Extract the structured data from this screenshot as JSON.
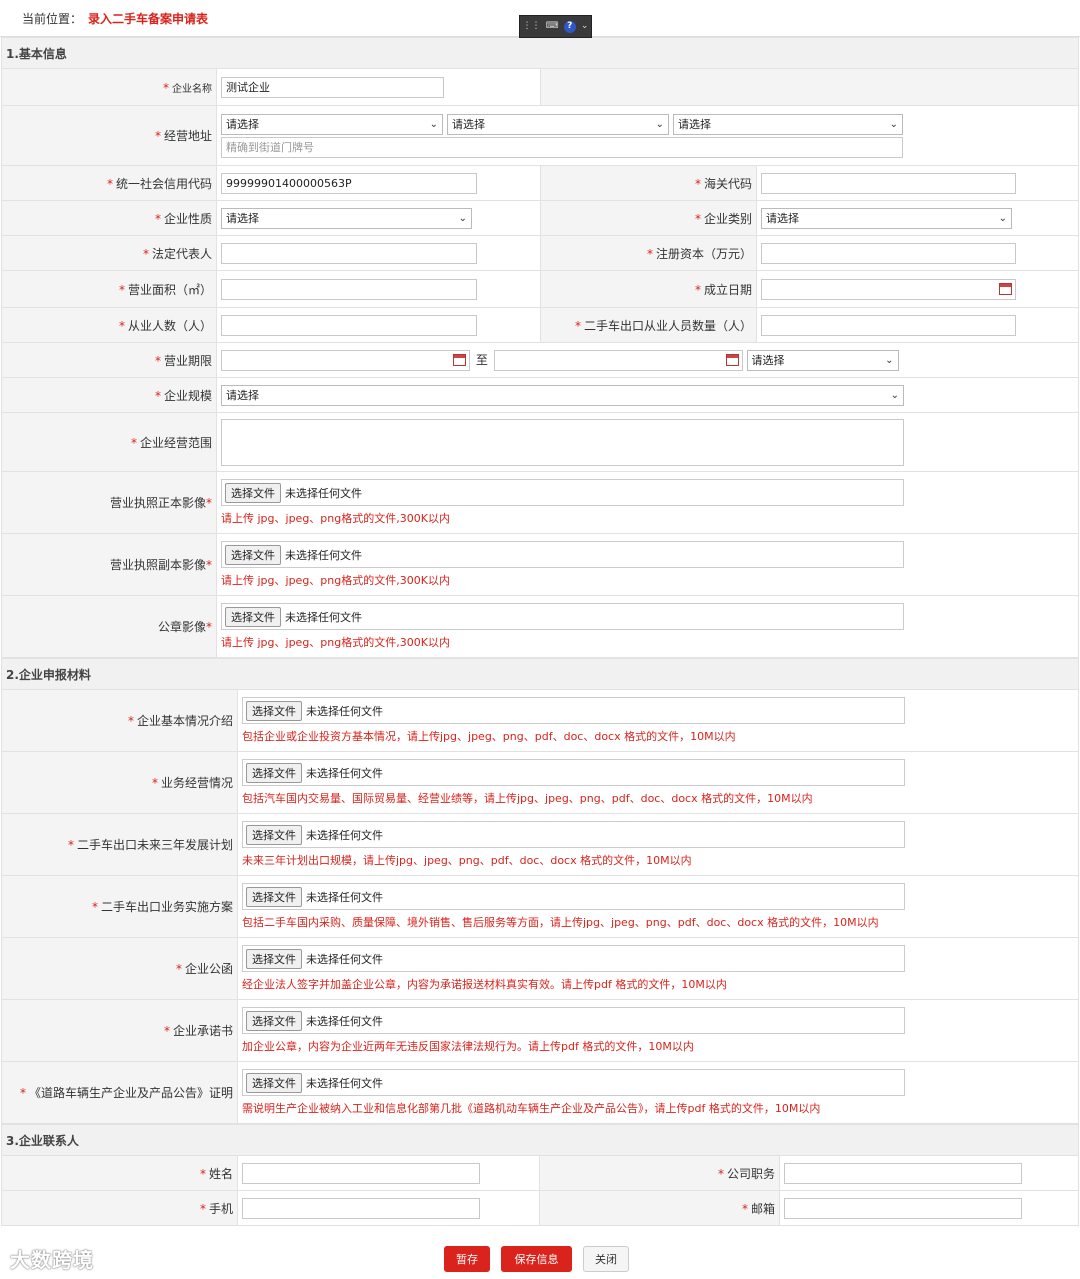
{
  "breadcrumb": {
    "label": "当前位置：",
    "current": "录入二手车备案申请表"
  },
  "sections": {
    "basic": "1.基本信息",
    "materials": "2.企业申报材料",
    "contact": "3.企业联系人"
  },
  "basic": {
    "company_name_label": "企业名称",
    "company_name_value": "测试企业",
    "address_label": "经营地址",
    "address_select1": "请选择",
    "address_select2": "请选择",
    "address_select3": "请选择",
    "address_detail_placeholder": "精确到街道门牌号",
    "credit_code_label": "统一社会信用代码",
    "credit_code_value": "99999901400000563P",
    "customs_code_label": "海关代码",
    "nature_label": "企业性质",
    "nature_value": "请选择",
    "category_label": "企业类别",
    "category_value": "请选择",
    "legal_rep_label": "法定代表人",
    "capital_label": "注册资本（万元）",
    "area_label": "营业面积（㎡）",
    "founded_label": "成立日期",
    "staff_label": "从业人数（人）",
    "export_staff_label": "二手车出口从业人员数量（人）",
    "term_label": "营业期限",
    "term_to": "至",
    "term_select": "请选择",
    "scale_label": "企业规模",
    "scale_value": "请选择",
    "scope_label": "企业经营范围",
    "license_main_label": "营业执照正本影像",
    "license_copy_label": "营业执照副本影像",
    "seal_label": "公章影像",
    "image_hint": "请上传 jpg、jpeg、png格式的文件,300K以内"
  },
  "file": {
    "button": "选择文件",
    "none": "未选择任何文件"
  },
  "materials": [
    {
      "label": "企业基本情况介绍",
      "hint": "包括企业或企业投资方基本情况，请上传jpg、jpeg、png、pdf、doc、docx 格式的文件，10M以内"
    },
    {
      "label": "业务经营情况",
      "hint": "包括汽车国内交易量、国际贸易量、经营业绩等，请上传jpg、jpeg、png、pdf、doc、docx 格式的文件，10M以内"
    },
    {
      "label": "二手车出口未来三年发展计划",
      "hint": "未来三年计划出口规模，请上传jpg、jpeg、png、pdf、doc、docx 格式的文件，10M以内"
    },
    {
      "label": "二手车出口业务实施方案",
      "hint": "包括二手车国内采购、质量保障、境外销售、售后服务等方面，请上传jpg、jpeg、png、pdf、doc、docx 格式的文件，10M以内"
    },
    {
      "label": "企业公函",
      "hint": "经企业法人签字并加盖企业公章，内容为承诺报送材料真实有效。请上传pdf 格式的文件，10M以内"
    },
    {
      "label": "企业承诺书",
      "hint": "加企业公章，内容为企业近两年无违反国家法律法规行为。请上传pdf 格式的文件，10M以内"
    },
    {
      "label": "《道路车辆生产企业及产品公告》证明",
      "hint": "需说明生产企业被纳入工业和信息化部第几批《道路机动车辆生产企业及产品公告》，请上传pdf 格式的文件，10M以内"
    }
  ],
  "contact": {
    "name_label": "姓名",
    "position_label": "公司职务",
    "phone_label": "手机",
    "email_label": "邮箱"
  },
  "buttons": {
    "draft": "暂存",
    "save": "保存信息",
    "close": "关闭"
  },
  "watermark": "大数跨境",
  "colors": {
    "required": "#d9231c",
    "primary_button": "#d9231c",
    "label_bg": "#f4f4f4"
  }
}
